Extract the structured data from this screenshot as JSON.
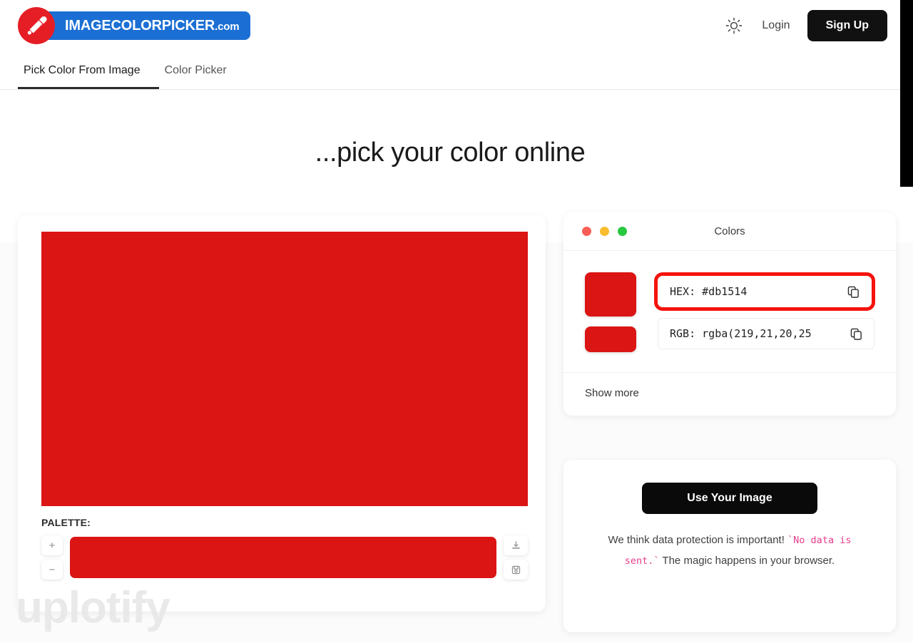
{
  "header": {
    "brand_name": "IMAGECOLORPICKER",
    "brand_suffix": ".com",
    "theme_toggle_icon": "sun-icon",
    "login_label": "Login",
    "signup_label": "Sign Up",
    "tabs": [
      {
        "label": "Pick Color From Image",
        "active": true
      },
      {
        "label": "Color Picker",
        "active": false
      }
    ]
  },
  "hero": {
    "title": "...pick your color online"
  },
  "picker": {
    "image_color": "#db1514",
    "palette_label": "PALETTE:",
    "add_label": "+",
    "remove_label": "−",
    "download_icon": "download-icon",
    "save_icon": "save-icon",
    "palette_colors": [
      "#db1514"
    ]
  },
  "colors_panel": {
    "window_title": "Colors",
    "traffic_lights": [
      "#fa5e57",
      "#f7bd2e",
      "#28c840"
    ],
    "swatch_color": "#db1514",
    "rows": [
      {
        "label": "HEX:",
        "value": "#db1514",
        "text": "HEX: #db1514",
        "highlighted": true,
        "copy_icon": "copy-icon"
      },
      {
        "label": "RGB:",
        "value": "rgba(219,21,20,25",
        "text": "RGB: rgba(219,21,20,25",
        "highlighted": false,
        "copy_icon": "copy-icon"
      }
    ],
    "show_more_label": "Show more",
    "highlight_color": "#f5130c"
  },
  "upload_card": {
    "button_label": "Use Your Image",
    "privacy_prefix": "We think data protection is important! ",
    "privacy_code": "`No data is sent.`",
    "privacy_suffix": " The magic happens in your browser."
  },
  "watermark": {
    "text": "uplotify"
  }
}
